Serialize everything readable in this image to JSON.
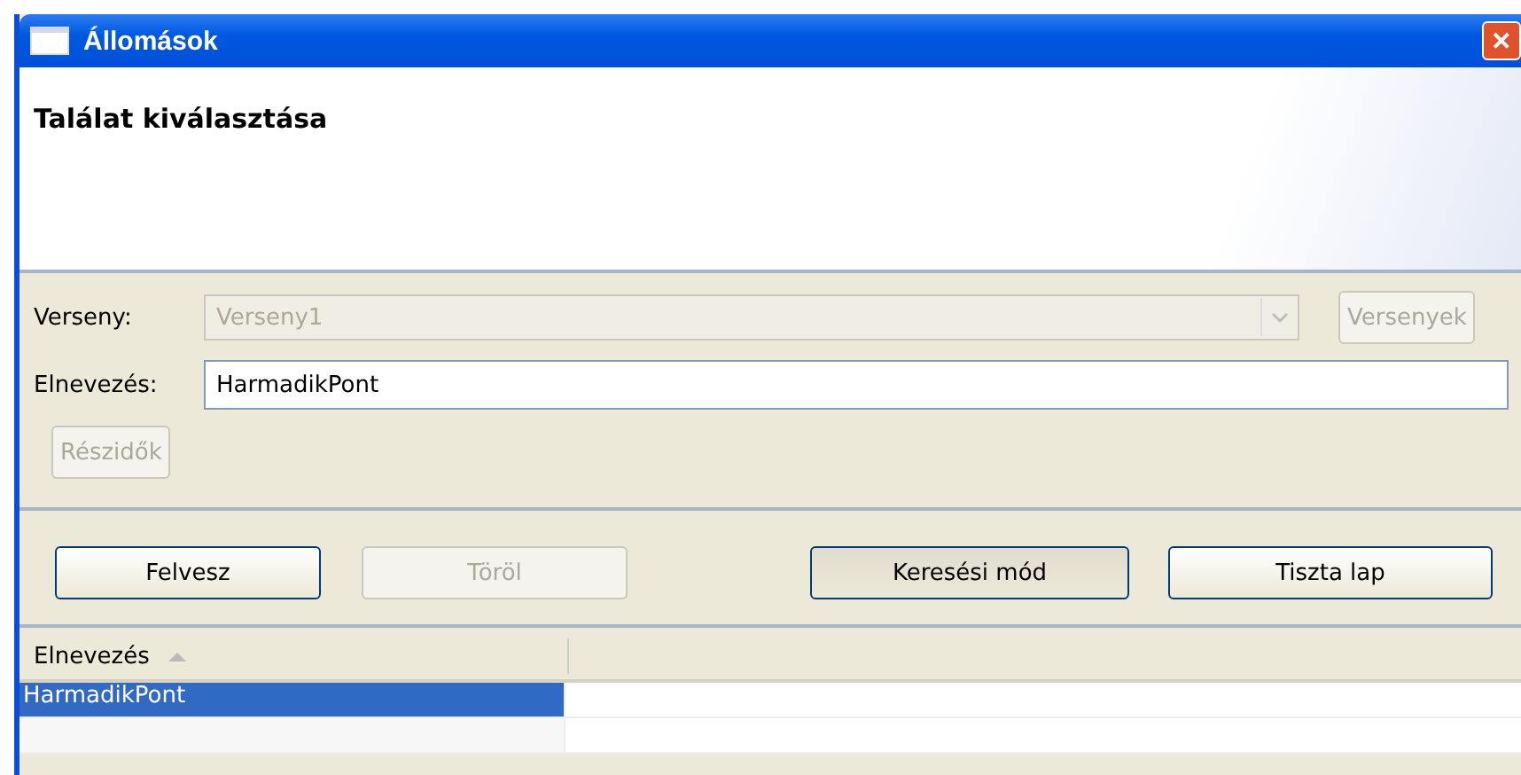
{
  "window": {
    "title": "Állomások",
    "close": "✕"
  },
  "header": {
    "title": "Találat kiválasztása"
  },
  "form": {
    "verseny": {
      "label": "Verseny:",
      "value": "Verseny1",
      "disabled": true
    },
    "versenyek_button": {
      "label": "Versenyek",
      "disabled": true
    },
    "elnevezes": {
      "label": "Elnevezés:",
      "value": "HarmadikPont"
    },
    "reszidok_button": {
      "label": "Részidők",
      "disabled": true
    }
  },
  "buttons": [
    {
      "label": "Felvesz",
      "disabled": false,
      "pressed": false
    },
    {
      "label": "Töröl",
      "disabled": true,
      "pressed": false
    },
    {
      "label": "Keresési mód",
      "disabled": false,
      "pressed": true
    },
    {
      "label": "Tiszta lap",
      "disabled": false,
      "pressed": false
    }
  ],
  "table": {
    "columns": [
      {
        "label": "Elnevezés",
        "sorted": true
      }
    ],
    "rows": [
      {
        "cells": [
          "HarmadikPont"
        ],
        "selected": true
      }
    ]
  }
}
